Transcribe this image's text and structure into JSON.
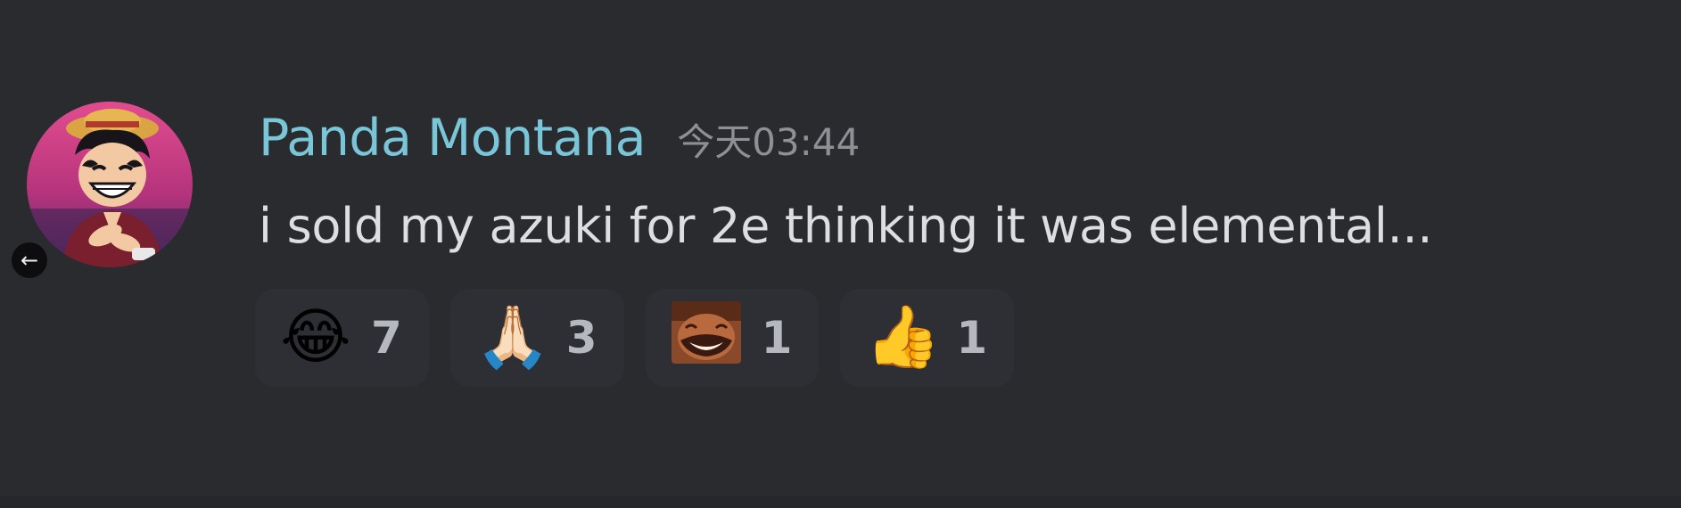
{
  "message": {
    "author": "Panda Montana",
    "timestamp": "今天03:44",
    "content": "i sold my azuki for 2e thinking it was elemental...",
    "avatar": "luffy-avatar",
    "reactions": [
      {
        "emoji": "😂",
        "name": "joy-emoji-icon",
        "count": "7"
      },
      {
        "emoji": "🙏🏻",
        "name": "folded-hands-emoji-icon",
        "count": "3"
      },
      {
        "emoji": "",
        "name": "laughing-man-custom-emoji-icon",
        "count": "1"
      },
      {
        "emoji": "👍",
        "name": "thumbs-up-emoji-icon",
        "count": "1"
      }
    ]
  },
  "colors": {
    "background": "#2a2b2f",
    "username": "#7ac6d9",
    "timestamp": "#8e9096",
    "text": "#dcdee2",
    "reaction_bg": "#2e2f34"
  },
  "icons": {
    "back": "←"
  }
}
